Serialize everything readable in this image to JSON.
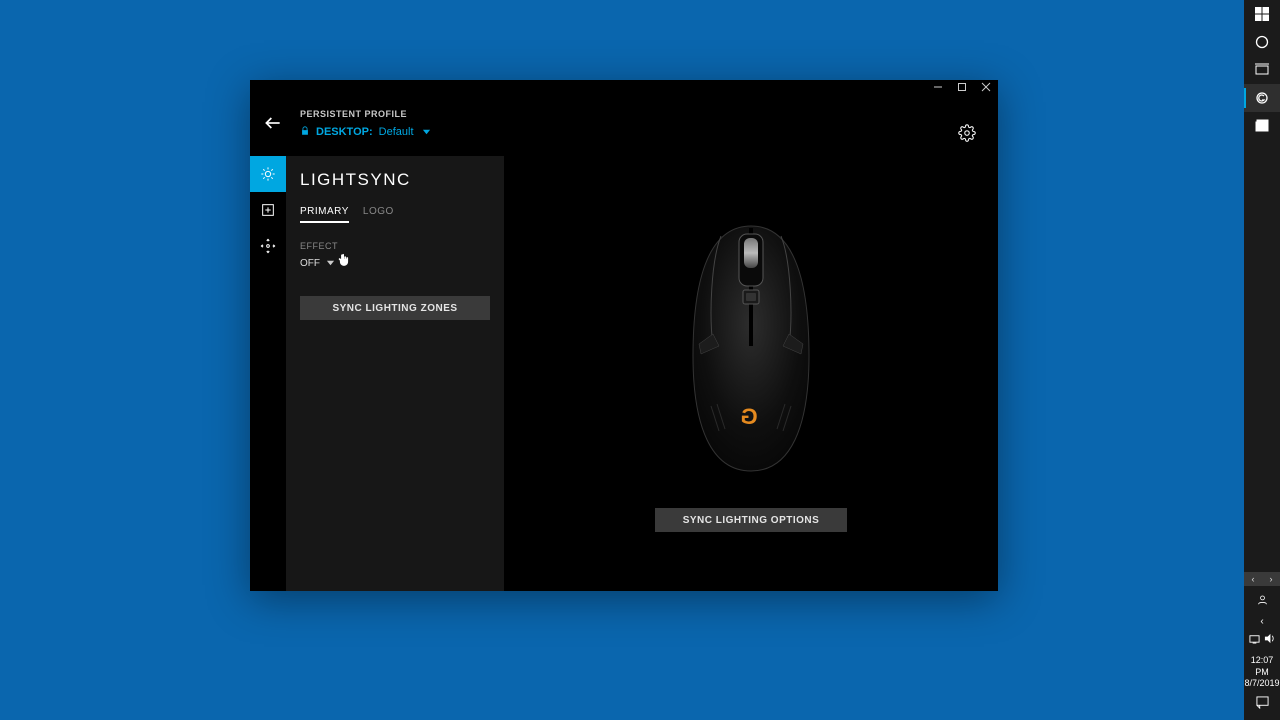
{
  "header": {
    "profile_label": "PERSISTENT PROFILE",
    "desktop_label": "DESKTOP:",
    "default_label": "Default"
  },
  "panel": {
    "title": "LIGHTSYNC",
    "tabs": {
      "primary": "PRIMARY",
      "logo": "LOGO"
    },
    "effect_label": "EFFECT",
    "effect_value": "OFF",
    "sync_zones": "SYNC LIGHTING ZONES"
  },
  "main": {
    "sync_options": "SYNC LIGHTING OPTIONS"
  },
  "taskbar": {
    "time": "12:07 PM",
    "date": "8/7/2019"
  }
}
